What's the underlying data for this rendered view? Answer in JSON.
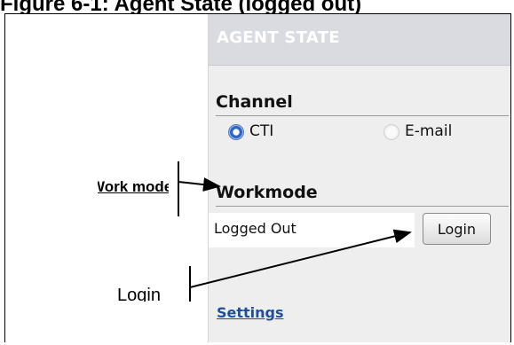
{
  "figure": {
    "caption": "Figure 6-1: Agent State (logged out)"
  },
  "panel": {
    "header": "AGENT STATE",
    "channel": {
      "title": "Channel",
      "options": [
        {
          "label": "CTI",
          "selected": true
        },
        {
          "label": "E-mail",
          "selected": false
        }
      ]
    },
    "workmode": {
      "title": "Workmode",
      "status": "Logged Out",
      "login_label": "Login"
    },
    "settings_label": "Settings"
  },
  "annotations": {
    "workmode_label": "Work mode:",
    "login_label": "Login"
  },
  "colors": {
    "panel_bg": "#eeeeee",
    "header_bg": "#d9dbe0",
    "link": "#1f4f9c",
    "radio_selected": "#2a66c9"
  }
}
